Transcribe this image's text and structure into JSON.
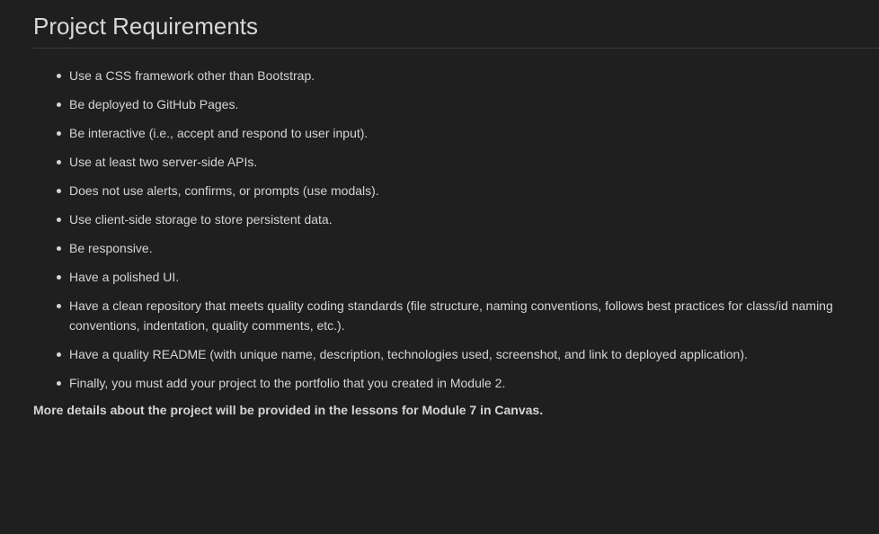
{
  "heading": "Project Requirements",
  "requirements": [
    "Use a CSS framework other than Bootstrap.",
    "Be deployed to GitHub Pages.",
    "Be interactive (i.e., accept and respond to user input).",
    "Use at least two server-side APIs.",
    "Does not use alerts, confirms, or prompts (use modals).",
    "Use client-side storage to store persistent data.",
    "Be responsive.",
    "Have a polished UI.",
    "Have a clean repository that meets quality coding standards (file structure, naming conventions, follows best practices for class/id naming conventions, indentation, quality comments, etc.).",
    "Have a quality README (with unique name, description, technologies used, screenshot, and link to deployed application).",
    "Finally, you must add your project to the portfolio that you created in Module 2."
  ],
  "footnote": "More details about the project will be provided in the lessons for Module 7 in Canvas.",
  "colors": {
    "background": "#1f1f1f",
    "text": "#d4d4d4",
    "divider": "#3c3c3c"
  }
}
